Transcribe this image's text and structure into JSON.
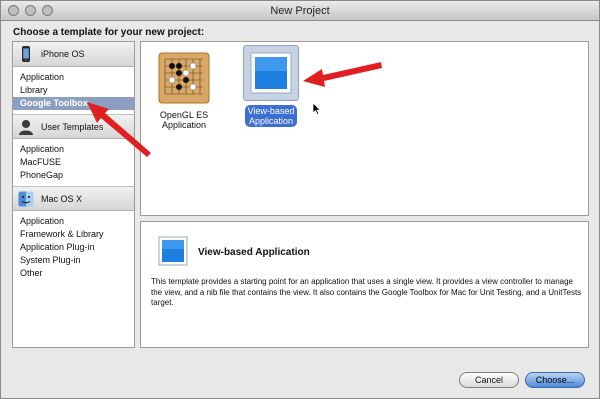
{
  "window": {
    "title": "New Project"
  },
  "prompt": "Choose a template for your new project:",
  "sidebar": {
    "groups": [
      {
        "label": "iPhone OS",
        "items": [
          "Application",
          "Library",
          "Google Toolbox"
        ],
        "selected_index": 2
      },
      {
        "label": "User Templates",
        "items": [
          "Application",
          "MacFUSE",
          "PhoneGap"
        ]
      },
      {
        "label": "Mac OS X",
        "items": [
          "Application",
          "Framework & Library",
          "Application Plug-in",
          "System Plug-in",
          "Other"
        ]
      }
    ]
  },
  "templates": [
    {
      "label_line1": "OpenGL ES",
      "label_line2": "Application",
      "icon": "go-board-icon",
      "selected": false
    },
    {
      "label_line1": "View-based",
      "label_line2": "Application",
      "icon": "blue-view-icon",
      "selected": true
    }
  ],
  "description": {
    "title": "View-based Application",
    "body": "This template provides a starting point for an application that uses a single view. It provides a view controller to manage the view, and a nib file that contains the view.  It also contains the Google Toolbox for Mac for Unit Testing, and a UnitTests target."
  },
  "buttons": {
    "cancel": "Cancel",
    "choose": "Choose..."
  },
  "colors": {
    "selection": "#8d9fc0",
    "accent": "#3b6fd2",
    "arrow": "#e02020"
  }
}
